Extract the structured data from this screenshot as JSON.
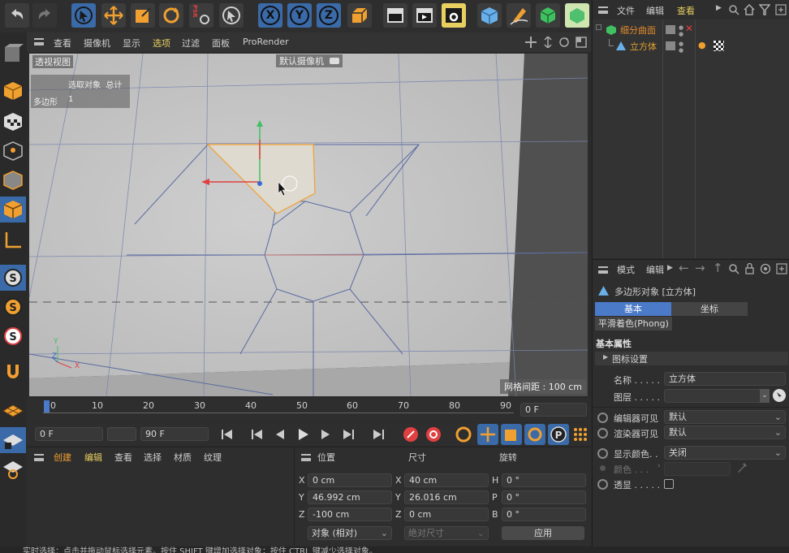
{
  "toolbar": {
    "psr_label": "PSR",
    "axis_x": "X",
    "axis_y": "Y",
    "axis_z": "Z"
  },
  "viewport_menu": {
    "items": [
      "查看",
      "摄像机",
      "显示",
      "选项",
      "过滤",
      "面板",
      "ProRender"
    ],
    "active_index": 3
  },
  "viewport": {
    "view_name": "透视视图",
    "camera_name": "默认摄像机",
    "info_headers": "选取对象  总计",
    "info_row_label": "多边形",
    "info_row_value": "1",
    "grid_spacing": "网格间距 : 100 cm",
    "axis_y": "Y",
    "axis_z": "Z",
    "axis_x": "X"
  },
  "timeline": {
    "ticks": [
      "0",
      "10",
      "20",
      "30",
      "40",
      "50",
      "60",
      "70",
      "80",
      "90"
    ],
    "current_frame_field": "0 F",
    "start_field": "0 F",
    "end_field": "90 F"
  },
  "material_panel": {
    "tabs": [
      "创建",
      "编辑",
      "查看",
      "选择",
      "材质",
      "纹理"
    ]
  },
  "coords": {
    "headers": {
      "position": "位置",
      "size": "尺寸",
      "rotation": "旋转"
    },
    "rows": [
      {
        "axis": "X",
        "pos": "0 cm",
        "size_axis": "X",
        "size": "40 cm",
        "rot_axis": "H",
        "rot": "0 °"
      },
      {
        "axis": "Y",
        "pos": "46.992 cm",
        "size_axis": "Y",
        "size": "26.016 cm",
        "rot_axis": "P",
        "rot": "0 °"
      },
      {
        "axis": "Z",
        "pos": "-100 cm",
        "size_axis": "Z",
        "size": "0 cm",
        "rot_axis": "B",
        "rot": "0 °"
      }
    ],
    "mode_select": "对象 (相对)",
    "size_mode_select": "绝对尺寸",
    "apply_button": "应用"
  },
  "object_manager": {
    "menu": [
      "文件",
      "编辑",
      "查看"
    ],
    "active_menu_index": 2,
    "objects": [
      {
        "name": "细分曲面",
        "color": "#e08a2c"
      },
      {
        "name": "立方体",
        "color": "#e0a030"
      }
    ]
  },
  "attribute_manager": {
    "menu": [
      "模式",
      "编辑"
    ],
    "object_title": "多边形对象 [立方体]",
    "tabs": [
      "基本",
      "坐标"
    ],
    "active_tab_index": 0,
    "sub_tab": "平滑着色(Phong)",
    "section_title": "基本属性",
    "icon_settings": "图标设置",
    "name_label": "名称 . . . . .",
    "name_value": "立方体",
    "layer_label": "图层 . . . . .",
    "editor_visible_label": "编辑器可见",
    "editor_visible_value": "默认",
    "render_visible_label": "渲染器可见",
    "render_visible_value": "默认",
    "display_color_label": "显示颜色. .",
    "display_color_value": "关闭",
    "color_label": "颜色 . . .",
    "xray_label": "透显 . . . . ."
  },
  "status_bar": {
    "text": "实时选择：点击并拖动鼠标选择元素。按住 SHIFT 键增加选择对象；按住 CTRL 键减少选择对象。"
  },
  "colors": {
    "accent_blue": "#3a6aa8",
    "active_orange": "#f0a030",
    "active_yellow": "#e8d060",
    "panel_bg": "#2b2b2b",
    "viewport_bg": "#c8c8c8"
  }
}
